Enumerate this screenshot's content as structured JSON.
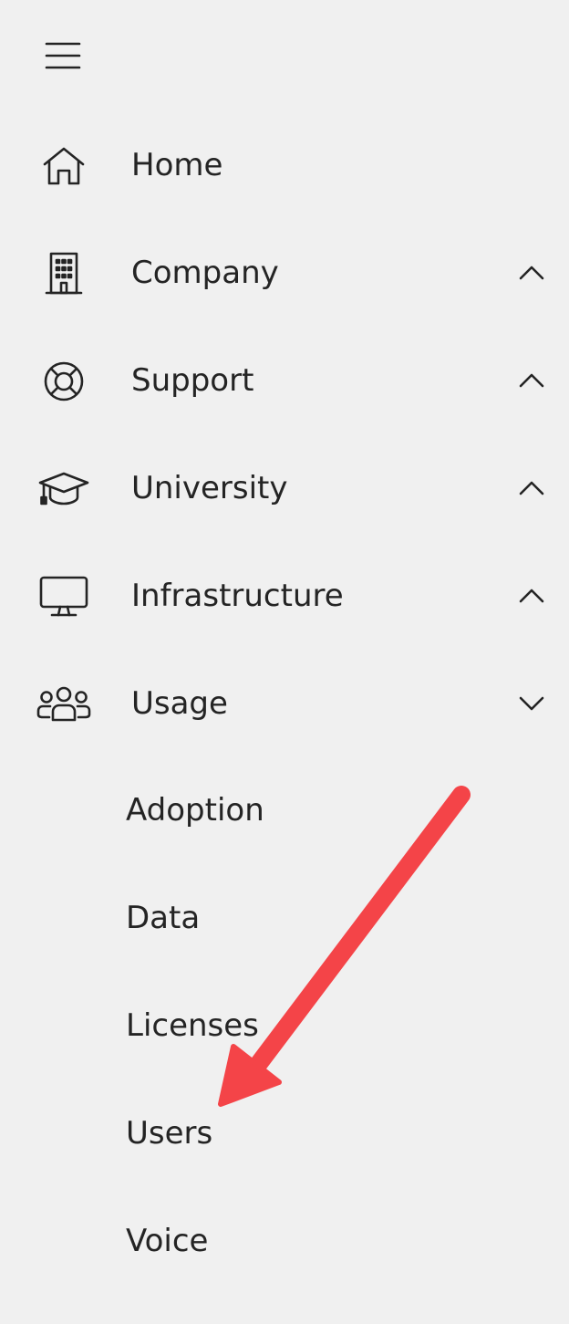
{
  "nav": {
    "menu_icon": "hamburger-icon",
    "items": [
      {
        "label": "Home",
        "icon": "home-icon",
        "chevron": "none"
      },
      {
        "label": "Company",
        "icon": "building-icon",
        "chevron": "up"
      },
      {
        "label": "Support",
        "icon": "lifebuoy-icon",
        "chevron": "up"
      },
      {
        "label": "University",
        "icon": "graduation-cap-icon",
        "chevron": "up"
      },
      {
        "label": "Infrastructure",
        "icon": "monitor-icon",
        "chevron": "up"
      },
      {
        "label": "Usage",
        "icon": "people-icon",
        "chevron": "down"
      }
    ],
    "usage_subitems": [
      "Adoption",
      "Data",
      "Licenses",
      "Users",
      "Voice"
    ]
  },
  "annotation": {
    "color": "#f44448",
    "points_to": "Users"
  }
}
